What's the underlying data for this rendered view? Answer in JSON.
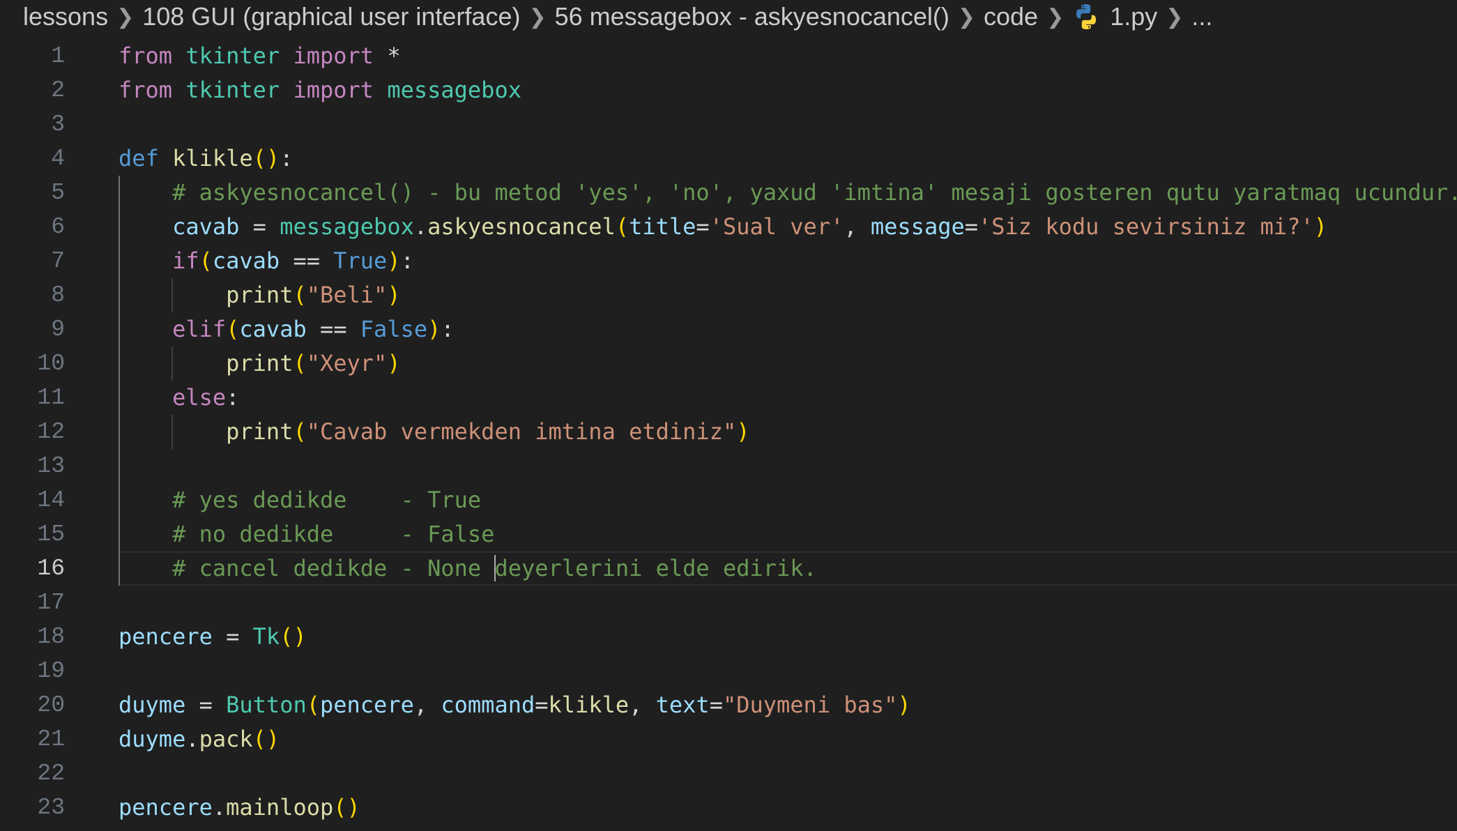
{
  "breadcrumb": {
    "items": [
      "lessons",
      "108 GUI (graphical user interface)",
      "56 messagebox - askyesnocancel()",
      "code"
    ],
    "file": "1.py",
    "more": "...",
    "file_icon": "python-icon"
  },
  "editor": {
    "current_line": 16,
    "line_numbers": [
      "1",
      "2",
      "3",
      "4",
      "5",
      "6",
      "7",
      "8",
      "9",
      "10",
      "11",
      "12",
      "13",
      "14",
      "15",
      "16",
      "17",
      "18",
      "19",
      "20",
      "21",
      "22",
      "23"
    ],
    "lines": [
      [
        [
          "kw-imp",
          "from"
        ],
        [
          "plain",
          " "
        ],
        [
          "mod",
          "tkinter"
        ],
        [
          "plain",
          " "
        ],
        [
          "kw-imp",
          "import"
        ],
        [
          "plain",
          " *"
        ]
      ],
      [
        [
          "kw-imp",
          "from"
        ],
        [
          "plain",
          " "
        ],
        [
          "mod",
          "tkinter"
        ],
        [
          "plain",
          " "
        ],
        [
          "kw-imp",
          "import"
        ],
        [
          "plain",
          " "
        ],
        [
          "mod",
          "messagebox"
        ]
      ],
      [],
      [
        [
          "kw-def",
          "def"
        ],
        [
          "plain",
          " "
        ],
        [
          "fn",
          "klikle"
        ],
        [
          "p1",
          "()"
        ],
        [
          "plain",
          ":"
        ]
      ],
      [
        [
          "plain",
          "    "
        ],
        [
          "cmt",
          "# askyesnocancel() - bu metod 'yes', 'no', yaxud 'imtina' mesaji gosteren qutu yaratmaq ucundur."
        ]
      ],
      [
        [
          "plain",
          "    "
        ],
        [
          "var",
          "cavab"
        ],
        [
          "plain",
          " = "
        ],
        [
          "mod",
          "messagebox"
        ],
        [
          "plain",
          "."
        ],
        [
          "fn",
          "askyesnocancel"
        ],
        [
          "p1",
          "("
        ],
        [
          "var",
          "title"
        ],
        [
          "plain",
          "="
        ],
        [
          "str",
          "'Sual ver'"
        ],
        [
          "plain",
          ", "
        ],
        [
          "var",
          "message"
        ],
        [
          "plain",
          "="
        ],
        [
          "str",
          "'Siz kodu sevirsiniz mi?'"
        ],
        [
          "p1",
          ")"
        ]
      ],
      [
        [
          "plain",
          "    "
        ],
        [
          "kw-imp",
          "if"
        ],
        [
          "p1",
          "("
        ],
        [
          "var",
          "cavab"
        ],
        [
          "plain",
          " == "
        ],
        [
          "cst",
          "True"
        ],
        [
          "p1",
          ")"
        ],
        [
          "plain",
          ":"
        ]
      ],
      [
        [
          "plain",
          "        "
        ],
        [
          "fn",
          "print"
        ],
        [
          "p1",
          "("
        ],
        [
          "str",
          "\"Beli\""
        ],
        [
          "p1",
          ")"
        ]
      ],
      [
        [
          "plain",
          "    "
        ],
        [
          "kw-imp",
          "elif"
        ],
        [
          "p1",
          "("
        ],
        [
          "var",
          "cavab"
        ],
        [
          "plain",
          " == "
        ],
        [
          "cst",
          "False"
        ],
        [
          "p1",
          ")"
        ],
        [
          "plain",
          ":"
        ]
      ],
      [
        [
          "plain",
          "        "
        ],
        [
          "fn",
          "print"
        ],
        [
          "p1",
          "("
        ],
        [
          "str",
          "\"Xeyr\""
        ],
        [
          "p1",
          ")"
        ]
      ],
      [
        [
          "plain",
          "    "
        ],
        [
          "kw-imp",
          "else"
        ],
        [
          "plain",
          ":"
        ]
      ],
      [
        [
          "plain",
          "        "
        ],
        [
          "fn",
          "print"
        ],
        [
          "p1",
          "("
        ],
        [
          "str",
          "\"Cavab vermekden imtina etdiniz\""
        ],
        [
          "p1",
          ")"
        ]
      ],
      [],
      [
        [
          "plain",
          "    "
        ],
        [
          "cmt",
          "# yes dedikde    - True"
        ]
      ],
      [
        [
          "plain",
          "    "
        ],
        [
          "cmt",
          "# no dedikde     - False"
        ]
      ],
      [
        [
          "plain",
          "    "
        ],
        [
          "cmt",
          "# cancel dedikde - None "
        ],
        [
          "cursor",
          ""
        ],
        [
          "cmt",
          "deyerlerini elde edirik."
        ]
      ],
      [],
      [
        [
          "var",
          "pencere"
        ],
        [
          "plain",
          " = "
        ],
        [
          "cls",
          "Tk"
        ],
        [
          "p1",
          "()"
        ]
      ],
      [],
      [
        [
          "var",
          "duyme"
        ],
        [
          "plain",
          " = "
        ],
        [
          "cls",
          "Button"
        ],
        [
          "p1",
          "("
        ],
        [
          "var",
          "pencere"
        ],
        [
          "plain",
          ", "
        ],
        [
          "var",
          "command"
        ],
        [
          "plain",
          "="
        ],
        [
          "fn",
          "klikle"
        ],
        [
          "plain",
          ", "
        ],
        [
          "var",
          "text"
        ],
        [
          "plain",
          "="
        ],
        [
          "str",
          "\"Duymeni bas\""
        ],
        [
          "p1",
          ")"
        ]
      ],
      [
        [
          "var",
          "duyme"
        ],
        [
          "plain",
          "."
        ],
        [
          "fn",
          "pack"
        ],
        [
          "p1",
          "()"
        ]
      ],
      [],
      [
        [
          "var",
          "pencere"
        ],
        [
          "plain",
          "."
        ],
        [
          "fn",
          "mainloop"
        ],
        [
          "p1",
          "()"
        ]
      ]
    ]
  }
}
